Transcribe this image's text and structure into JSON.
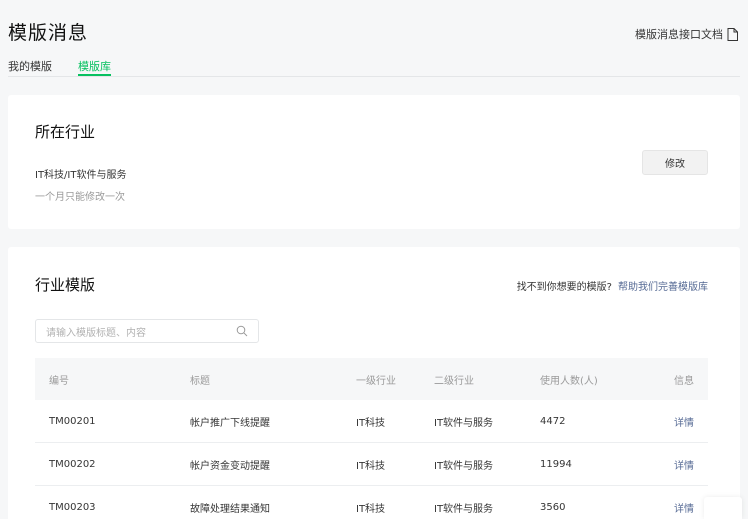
{
  "header": {
    "title": "模版消息",
    "doc_link": "模版消息接口文档"
  },
  "tabs": [
    {
      "label": "我的模版",
      "active": false
    },
    {
      "label": "模版库",
      "active": true
    }
  ],
  "industry_section": {
    "title": "所在行业",
    "value": "IT科技/IT软件与服务",
    "note": "一个月只能修改一次",
    "edit_button": "修改"
  },
  "template_section": {
    "title": "行业模版",
    "helper_text": "找不到你想要的模版?",
    "helper_link": "帮助我们完善模版库",
    "search_placeholder": "请输入模版标题、内容",
    "columns": [
      "编号",
      "标题",
      "一级行业",
      "二级行业",
      "使用人数(人)",
      "信息"
    ],
    "rows": [
      {
        "id": "TM00201",
        "title": "帐户推广下线提醒",
        "level1": "IT科技",
        "level2": "IT软件与服务",
        "users": "4472",
        "info": "详情"
      },
      {
        "id": "TM00202",
        "title": "帐户资金变动提醒",
        "level1": "IT科技",
        "level2": "IT软件与服务",
        "users": "11994",
        "info": "详情"
      },
      {
        "id": "TM00203",
        "title": "故障处理结果通知",
        "level1": "IT科技",
        "level2": "IT软件与服务",
        "users": "3560",
        "info": "详情"
      }
    ]
  },
  "colors": {
    "accent": "#07c160",
    "link": "#576b95",
    "background": "#f6f7f8"
  }
}
